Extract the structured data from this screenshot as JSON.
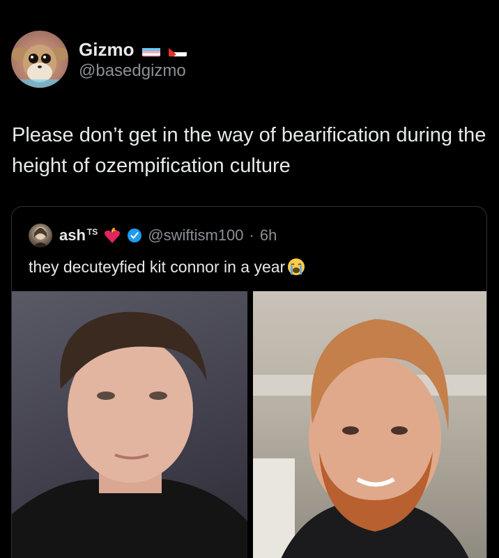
{
  "post": {
    "author": {
      "name": "Gizmo",
      "handle": "@basedgizmo",
      "flags": [
        "trans-flag-icon",
        "palestine-flag-icon"
      ]
    },
    "text": "Please don’t get in the way of bearification during the height of ozempification culture"
  },
  "quote": {
    "author": {
      "name": "ash",
      "name_superscript": "TS",
      "handle": "@swiftism100",
      "separator": "·",
      "time": "6h",
      "verified": true
    },
    "text": "they decuteyfied kit connor in a year",
    "emoji": "loudly-crying-face-icon",
    "images": [
      {
        "name": "before-photo",
        "description_icon": "portrait-clean-shaven"
      },
      {
        "name": "after-photo",
        "description_icon": "portrait-bearded"
      }
    ]
  },
  "colors": {
    "background": "#000000",
    "text": "#e7e9ea",
    "secondary_text": "#8b9096",
    "border": "#2f3336",
    "verified": "#1d9bf0"
  }
}
